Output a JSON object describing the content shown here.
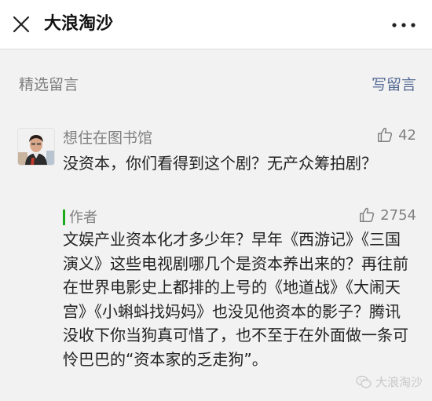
{
  "header": {
    "title": "大浪淘沙"
  },
  "section": {
    "title": "精选留言",
    "write_label": "写留言"
  },
  "comment": {
    "nickname": "想住在图书馆",
    "likes": "42",
    "text": "没资本，你们看得到这个剧？无产众筹拍剧？"
  },
  "reply": {
    "label": "作者",
    "likes": "2754",
    "text": "文娱产业资本化才多少年？早年《西游记》《三国演义》这些电视剧哪几个是资本养出来的？再往前在世界电影史上都排的上号的《地道战》《大闹天宫》《小蝌蚪找妈妈》也没见他资本的影子？腾讯没收下你当狗真可惜了，也不至于在外面做一条可怜巴巴的“资本家的乏走狗”。"
  },
  "watermark": {
    "text": "大浪淘沙"
  },
  "colors": {
    "link": "#576b95",
    "author_bar": "#1aad19",
    "background": "#f2f2f2"
  },
  "icons": {
    "close": "close-icon",
    "more": "more-icon",
    "like": "thumbs-up-icon",
    "watermark": "wechat-icon"
  }
}
